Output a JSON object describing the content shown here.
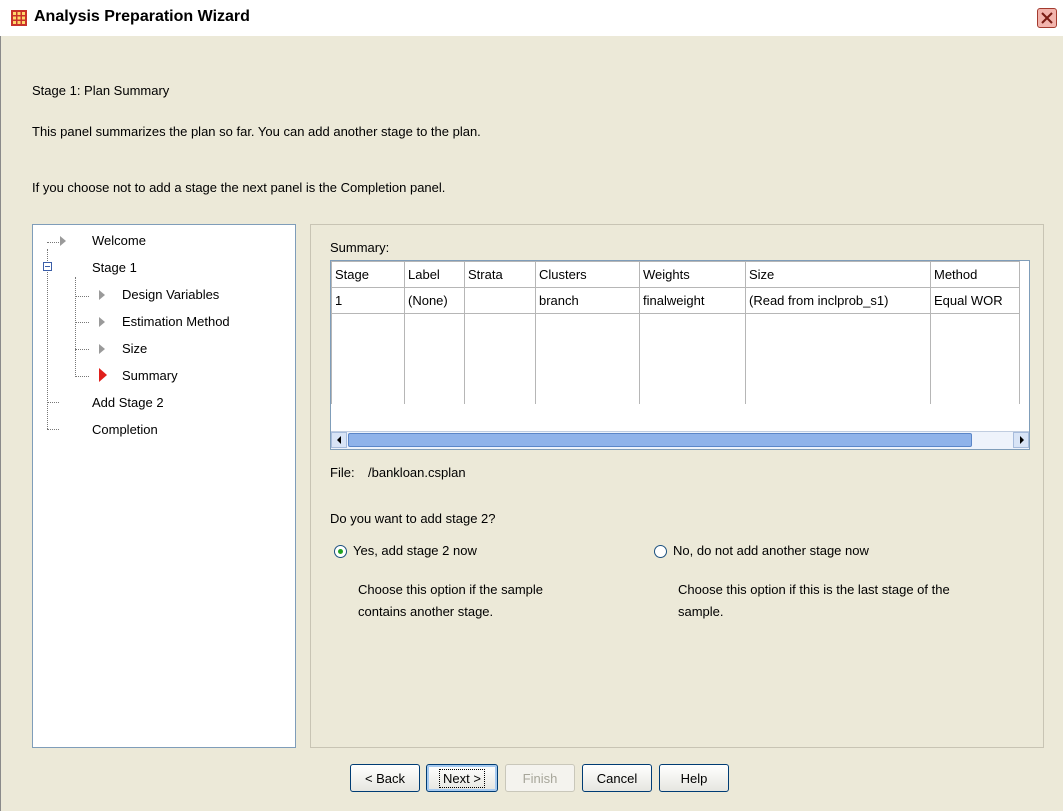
{
  "window": {
    "title": "Analysis Preparation Wizard"
  },
  "header": {
    "stage_title": "Stage 1: Plan Summary",
    "description": "This panel summarizes the plan so far. You can add another stage to the plan.",
    "note": "If you choose not to add a stage the next panel is the Completion panel."
  },
  "tree": {
    "items": [
      {
        "label": "Welcome"
      },
      {
        "label": "Stage 1"
      },
      {
        "label": "Design Variables"
      },
      {
        "label": "Estimation Method"
      },
      {
        "label": "Size"
      },
      {
        "label": "Summary"
      },
      {
        "label": "Add Stage 2"
      },
      {
        "label": "Completion"
      }
    ]
  },
  "summary": {
    "label": "Summary:",
    "columns": [
      "Stage",
      "Label",
      "Strata",
      "Clusters",
      "Weights",
      "Size",
      "Method"
    ],
    "rows": [
      [
        "1",
        "(None)",
        "",
        "branch",
        "finalweight",
        "(Read from inclprob_s1)",
        "Equal WOR"
      ]
    ]
  },
  "file": {
    "label": "File:",
    "value": "/bankloan.csplan"
  },
  "question": "Do you want to add stage 2?",
  "options": {
    "yes": {
      "label": "Yes, add stage 2 now",
      "description": "Choose this option if the sample contains another stage.",
      "checked": true
    },
    "no": {
      "label": "No, do not add another stage now",
      "description": "Choose this option if this is the last stage of the sample.",
      "checked": false
    }
  },
  "buttons": {
    "back": "< Back",
    "next": "Next >",
    "finish": "Finish",
    "cancel": "Cancel",
    "help": "Help"
  },
  "colors": {
    "accent_red": "#e0201c",
    "radio_green": "#21a121",
    "close_red": "#c84a3a"
  }
}
